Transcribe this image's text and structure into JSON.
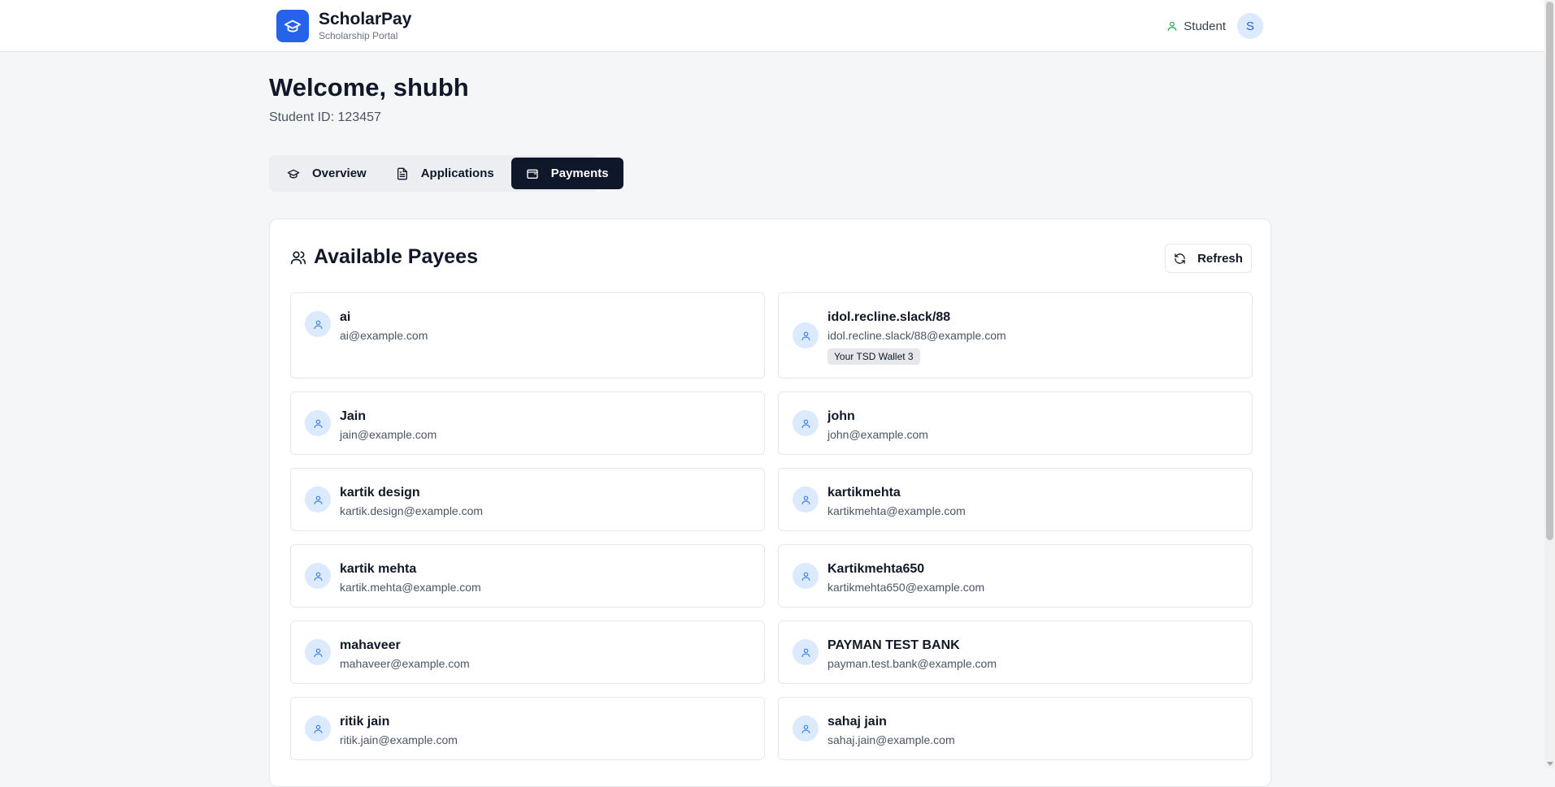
{
  "header": {
    "brand_name": "ScholarPay",
    "brand_sub": "Scholarship Portal",
    "role_label": "Student",
    "avatar_initial": "S"
  },
  "welcome": {
    "title": "Welcome, shubh",
    "student_id": "Student ID: 123457"
  },
  "tabs": [
    {
      "label": "Overview",
      "icon": "graduation-cap-icon",
      "active": false
    },
    {
      "label": "Applications",
      "icon": "document-icon",
      "active": false
    },
    {
      "label": "Payments",
      "icon": "wallet-icon",
      "active": true
    }
  ],
  "payees_section": {
    "title": "Available Payees",
    "refresh_label": "Refresh"
  },
  "payees": [
    {
      "name": "ai",
      "email": "ai@example.com"
    },
    {
      "name": "idol.recline.slack/88",
      "email": "idol.recline.slack/88@example.com",
      "badge": "Your TSD Wallet 3"
    },
    {
      "name": "Jain",
      "email": "jain@example.com"
    },
    {
      "name": "john",
      "email": "john@example.com"
    },
    {
      "name": "kartik design",
      "email": "kartik.design@example.com"
    },
    {
      "name": "kartikmehta",
      "email": "kartikmehta@example.com"
    },
    {
      "name": "kartik mehta",
      "email": "kartik.mehta@example.com"
    },
    {
      "name": "Kartikmehta650",
      "email": "kartikmehta650@example.com"
    },
    {
      "name": "mahaveer",
      "email": "mahaveer@example.com"
    },
    {
      "name": "PAYMAN TEST BANK",
      "email": "payman.test.bank@example.com"
    },
    {
      "name": "ritik jain",
      "email": "ritik.jain@example.com"
    },
    {
      "name": "sahaj jain",
      "email": "sahaj.jain@example.com"
    }
  ],
  "colors": {
    "brand": "#2563eb",
    "active_tab": "#0f172a",
    "role_icon": "#16a34a"
  }
}
